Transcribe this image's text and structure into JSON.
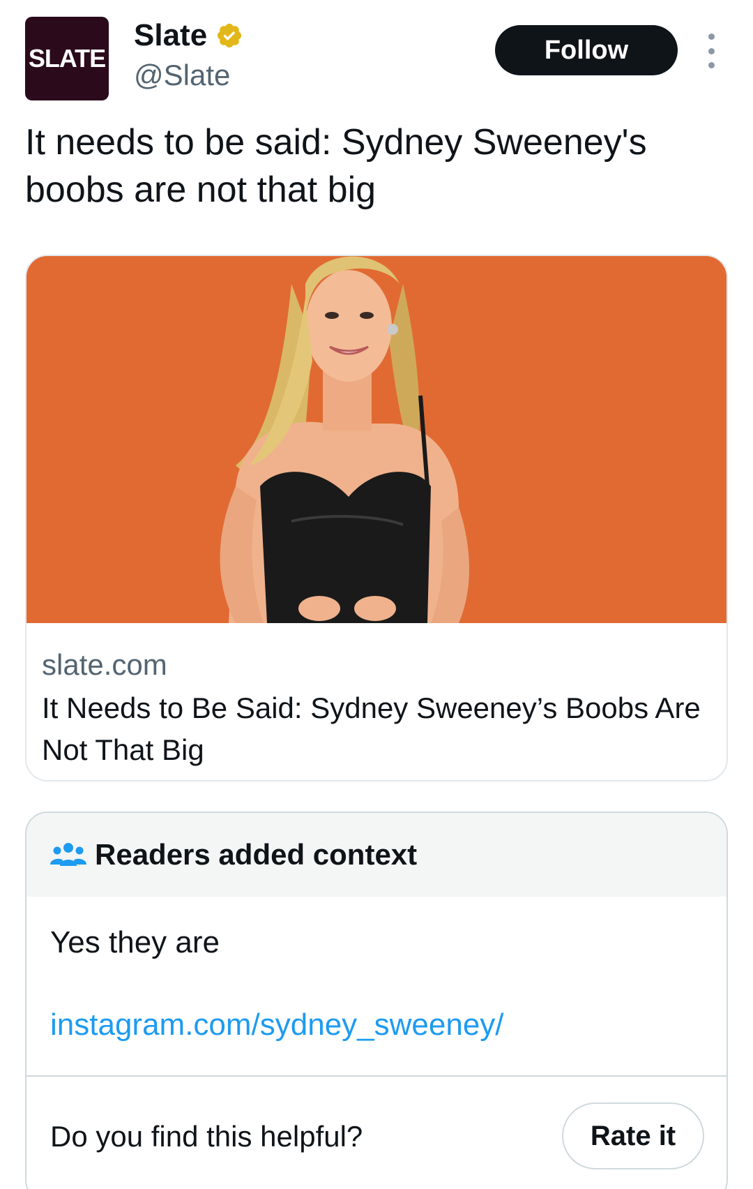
{
  "author": {
    "avatar_text": "SLATE",
    "display_name": "Slate",
    "handle": "@Slate",
    "verified_icon": "verified-badge-gold",
    "avatar_color": "#2b0a1c",
    "badge_color": "#e2b719"
  },
  "actions": {
    "follow_label": "Follow",
    "more_icon": "more-vertical-icon"
  },
  "tweet": {
    "text": "It needs to be said: Sydney Sweeney's boobs are not that big"
  },
  "link_card": {
    "domain": "slate.com",
    "title": "It Needs to Be Said: Sydney Sweeney’s Boobs Are Not That Big",
    "image_background": "#e16a33"
  },
  "community_note": {
    "header_icon": "people-group-icon",
    "header": "Readers added context",
    "text": "Yes they are",
    "link": "instagram.com/sydney_sweeney/",
    "helpful_prompt": "Do you find this helpful?",
    "rate_label": "Rate it",
    "link_color": "#1d9bf0"
  }
}
